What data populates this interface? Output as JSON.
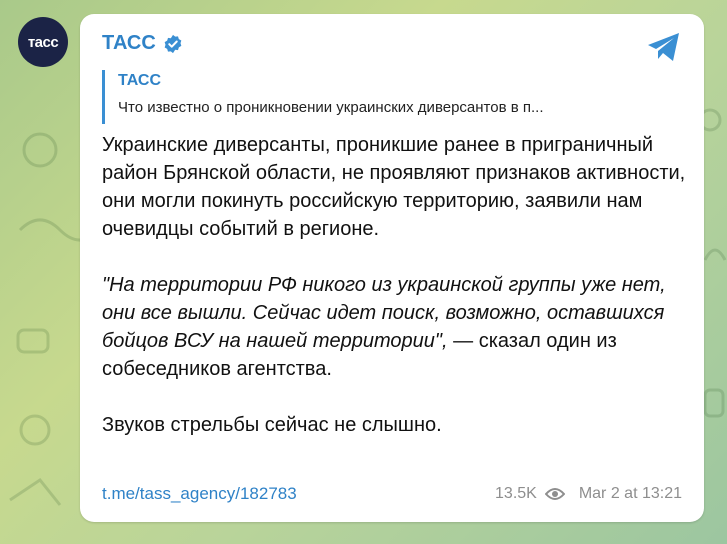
{
  "channel": {
    "avatar_text": "тасс",
    "name": "ТАСС"
  },
  "reply": {
    "author": "ТАСС",
    "text": "Что известно о проникновении украинских диверсантов в п..."
  },
  "message": {
    "paragraph1": "Украинские диверсанты, проникшие ранее в приграничный район Брянской области, не проявляют признаков активности, они могли покинуть российскую территорию, заявили нам очевидцы событий в регионе.",
    "quote": "\"На территории РФ никого из украинской группы уже нет, они все вышли. Сейчас идет поиск, возможно, оставшихся бойцов ВСУ на нашей территории\",",
    "quote_tail": " — сказал один из собеседников агентства.",
    "paragraph3": "Звуков стрельбы сейчас не слышно."
  },
  "footer": {
    "link": "t.me/tass_agency/182783",
    "views": "13.5K",
    "time": "Mar 2 at 13:21"
  },
  "icons": {
    "verified": "verified-badge-icon",
    "share": "telegram-plane-icon",
    "views": "eye-icon"
  },
  "colors": {
    "accent": "#2f82c7",
    "avatar_bg": "#1b2346",
    "bubble": "#ffffff"
  }
}
